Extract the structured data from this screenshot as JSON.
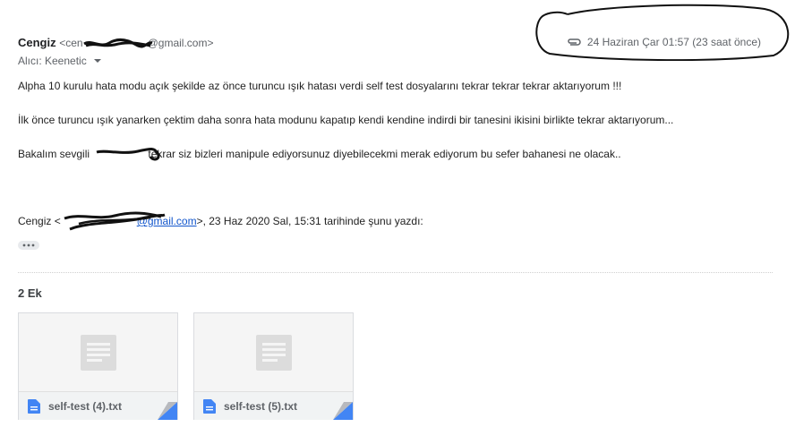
{
  "header": {
    "sender_name": "Cengiz",
    "sender_email": "<cen•••••••••••@gmail.com>",
    "sender_email_visible_suffix": "@gmail.com>",
    "sender_email_visible_prefix": "<cen",
    "date": "24 Haziran Çar 01:57 (23 saat önce)",
    "recipient_label": "Alıcı: Keenetic"
  },
  "body": {
    "paragraph1": "Alpha 10 kurulu hata modu açık şekilde az önce turuncu ışık hatası verdi self test dosyalarını tekrar tekrar tekrar aktarıyorum !!!",
    "paragraph2": "İlk önce turuncu ışık yanarken çektim daha sonra hata modunu kapatıp kendi kendine indirdi bir tanesini ikisini birlikte tekrar aktarıyorum...",
    "paragraph3_start": "Bakalım sevgili",
    "paragraph3_end": "tekrar siz bizleri manipule ediyorsunuz diyebilecekmi merak ediyorum bu sefer bahanesi ne olacak.."
  },
  "quote": {
    "prefix": "Cengiz <",
    "link_suffix": "@gmail.com",
    "suffix": ">, 23 Haz 2020 Sal, 15:31 tarihinde şunu yazdı:"
  },
  "attachments": {
    "count_label": "2 Ek",
    "items": [
      {
        "name": "self-test (4).txt"
      },
      {
        "name": "self-test (5).txt"
      }
    ]
  },
  "colors": {
    "link": "#1155cc",
    "file_icon": "#4285f4",
    "muted": "#5f6368"
  },
  "icons": {
    "attachment": "paperclip-icon",
    "dropdown": "chevron-down-icon",
    "file": "text-file-icon"
  }
}
